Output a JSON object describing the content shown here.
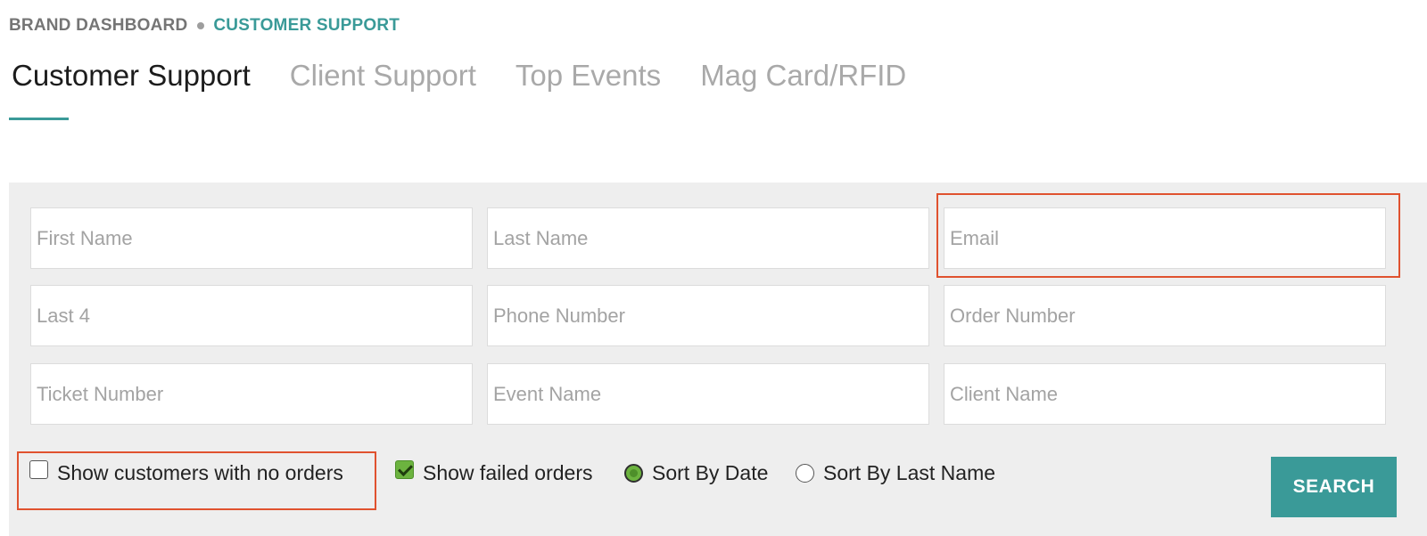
{
  "breadcrumb": {
    "root": "BRAND DASHBOARD",
    "current": "CUSTOMER SUPPORT"
  },
  "tabs": [
    {
      "label": "Customer Support",
      "active": true
    },
    {
      "label": "Client Support",
      "active": false
    },
    {
      "label": "Top Events",
      "active": false
    },
    {
      "label": "Mag Card/RFID",
      "active": false
    }
  ],
  "search_form": {
    "fields": [
      {
        "placeholder": "First Name",
        "value": ""
      },
      {
        "placeholder": "Last Name",
        "value": ""
      },
      {
        "placeholder": "Email",
        "value": ""
      },
      {
        "placeholder": "Last 4",
        "value": ""
      },
      {
        "placeholder": "Phone Number",
        "value": ""
      },
      {
        "placeholder": "Order Number",
        "value": ""
      },
      {
        "placeholder": "Ticket Number",
        "value": ""
      },
      {
        "placeholder": "Event Name",
        "value": ""
      },
      {
        "placeholder": "Client Name",
        "value": ""
      }
    ],
    "options": {
      "show_no_orders": {
        "label": "Show customers with no orders",
        "checked": false
      },
      "show_failed": {
        "label": "Show failed orders",
        "checked": true
      },
      "sort_by_date": {
        "label": "Sort By Date",
        "selected": true
      },
      "sort_by_last_name": {
        "label": "Sort By Last Name",
        "selected": false
      }
    },
    "search_label": "SEARCH"
  },
  "colors": {
    "accent": "#3a9a98",
    "highlight": "#e0522f",
    "checked_green": "#6cb33f",
    "panel_bg": "#eeeeee"
  }
}
